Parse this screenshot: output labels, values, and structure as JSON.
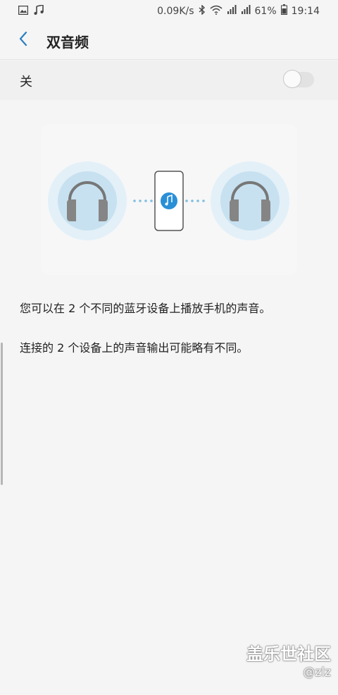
{
  "status": {
    "speed": "0.09K/s",
    "battery": "61%",
    "time": "19:14",
    "icons": [
      "image-icon",
      "music-note-icon",
      "bluetooth-icon",
      "wifi-icon",
      "signal-icon",
      "signal-icon",
      "battery-icon"
    ]
  },
  "header": {
    "title": "双音频"
  },
  "toggle": {
    "label": "关",
    "state": "off"
  },
  "illustration": {
    "icons": [
      "headphones-icon",
      "phone-icon",
      "music-note-icon",
      "headphones-icon"
    ],
    "accent": "#2a8fd6",
    "ring_color": "#d6eaf5"
  },
  "content": {
    "desc1": "您可以在 2 个不同的蓝牙设备上播放手机的声音。",
    "desc2": "连接的 2 个设备上的声音输出可能略有不同。"
  },
  "watermark": {
    "main": "盖乐世社区",
    "sub": "@zlz"
  }
}
